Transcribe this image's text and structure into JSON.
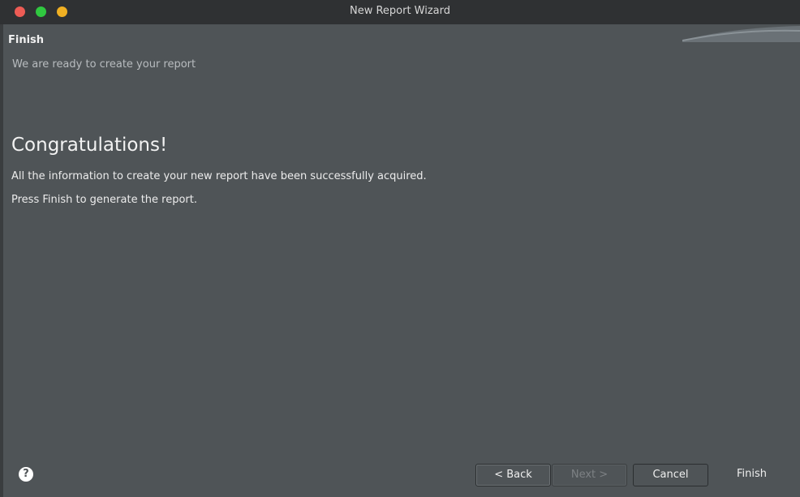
{
  "window": {
    "title": "New Report Wizard"
  },
  "page": {
    "heading": "Finish",
    "description": "We are ready to create your report"
  },
  "content": {
    "congrats": "Congratulations!",
    "line1": "All the information to create your new report have been successfully acquired.",
    "line2": "Press Finish to generate the report."
  },
  "buttons": {
    "help_icon": "question-mark-icon",
    "help_glyph": "?",
    "back": "< Back",
    "next": "Next >",
    "cancel": "Cancel",
    "finish": "Finish"
  },
  "colors": {
    "background": "#4f5457",
    "titlebar": "#2f3133",
    "close": "#ed5c55",
    "maximize": "#30c840",
    "minimize": "#f0b023"
  }
}
